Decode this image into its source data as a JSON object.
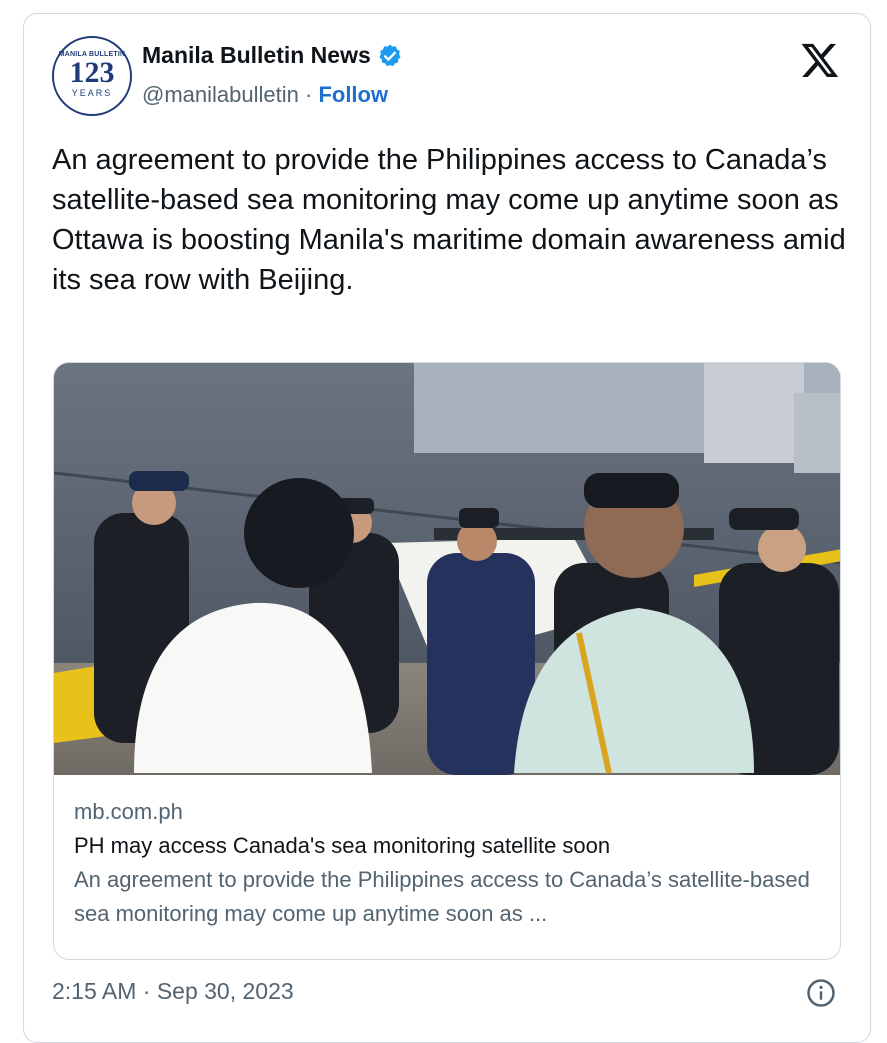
{
  "account": {
    "avatar": {
      "top_text": "MANILA BULLETIN",
      "number": "123",
      "years": "YEARS"
    },
    "name": "Manila Bulletin News",
    "handle": "@manilabulletin",
    "separator": "·",
    "follow_label": "Follow"
  },
  "tweet": {
    "text": "An agreement to provide the Philippines access to Canada’s satellite-based sea monitoring may come up anytime soon as Ottawa is boosting Manila's maritime domain awareness amid its sea row with Beijing."
  },
  "link_card": {
    "domain": "mb.com.ph",
    "title": "PH may access Canada's sea monitoring satellite soon",
    "description": "An agreement to provide the Philippines access to Canada’s satellite-based sea monitoring may come up anytime soon as ..."
  },
  "footer": {
    "timestamp": "2:15 AM · Sep 30, 2023"
  },
  "icons": {
    "verified": "verified-badge-icon",
    "x_logo": "x-logo-icon",
    "info": "info-icon"
  },
  "colors": {
    "follow": "#1d6fd2",
    "verified": "#1d9bf0",
    "muted": "#536471",
    "text": "#0f1419"
  }
}
